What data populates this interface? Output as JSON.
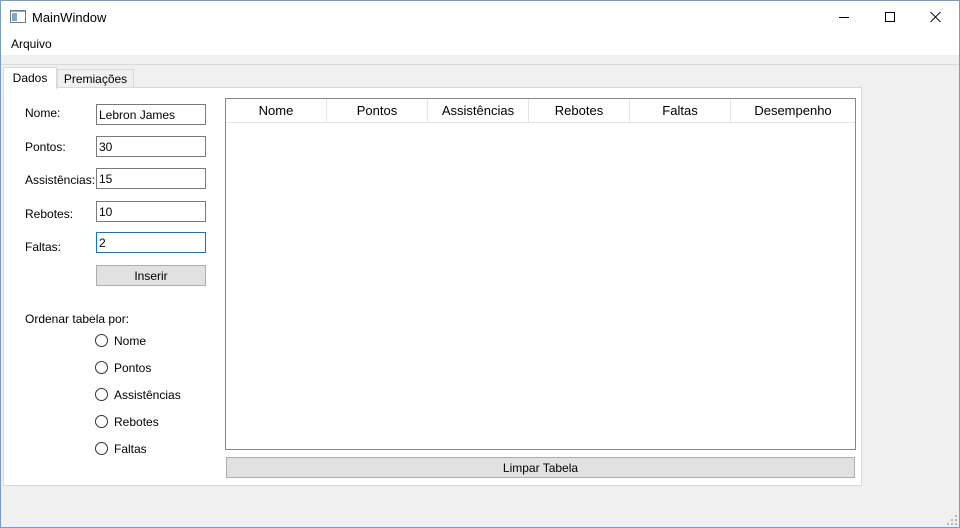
{
  "window": {
    "title": "MainWindow",
    "icon": "app-window-icon"
  },
  "menubar": {
    "items": [
      {
        "label": "Arquivo"
      }
    ]
  },
  "tabs": [
    {
      "label": "Dados",
      "active": true
    },
    {
      "label": "Premiações",
      "active": false
    }
  ],
  "form": {
    "fields": [
      {
        "label": "Nome:",
        "value": "Lebron James"
      },
      {
        "label": "Pontos:",
        "value": "30"
      },
      {
        "label": "Assistências:",
        "value": "15"
      },
      {
        "label": "Rebotes:",
        "value": "10"
      },
      {
        "label": "Faltas:",
        "value": "2"
      }
    ],
    "insert_label": "Inserir",
    "sort_label": "Ordenar tabela por:",
    "sort_options": [
      "Nome",
      "Pontos",
      "Assistências",
      "Rebotes",
      "Faltas"
    ]
  },
  "table": {
    "columns": [
      "Nome",
      "Pontos",
      "Assistências",
      "Rebotes",
      "Faltas",
      "Desempenho"
    ],
    "rows": []
  },
  "clear_label": "Limpar Tabela",
  "colors": {
    "focus": "#0078d7",
    "button_face": "#e1e1e1",
    "window_border": "#7a9cc4"
  }
}
